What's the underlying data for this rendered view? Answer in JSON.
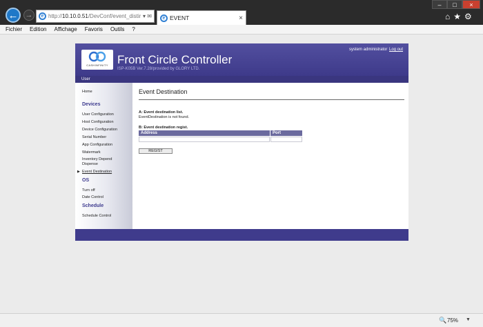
{
  "browser": {
    "url_prefix": "http://",
    "url_host": "10.10.0.51",
    "url_path": "/DevConf/event_distir",
    "tab_title": "EVENT",
    "menu": [
      "Fichier",
      "Edition",
      "Affichage",
      "Favoris",
      "Outils",
      "?"
    ],
    "zoom": "75%"
  },
  "header": {
    "logo_caption": "CASHINFINITY",
    "title": "Front Circle Controller",
    "version": "ISP-K05B Ver.7.28/provided by GLORY LTD.",
    "user": "system administrator",
    "logout": "Log out"
  },
  "user_bar": "User",
  "sidebar": {
    "home": "Home",
    "devices_title": "Devices",
    "devices": [
      "User Configuration",
      "Host Configuration",
      "Device Configuration",
      "Serial Number",
      "App Configuration",
      "Watermark",
      "Inventory Depend",
      "Dispense",
      "Event Destination"
    ],
    "os_title": "OS",
    "os": [
      "Turn off",
      "Date Control"
    ],
    "schedule_title": "Schedule",
    "schedule": [
      "Schedule Control"
    ]
  },
  "content": {
    "title": "Event Destination",
    "section_a": "A: Event destination list.",
    "section_a_msg": "EventDestination is not found.",
    "section_b": "B: Event destination regist.",
    "col_address": "Address",
    "col_port": "Port",
    "regist_button": "REGIST"
  }
}
